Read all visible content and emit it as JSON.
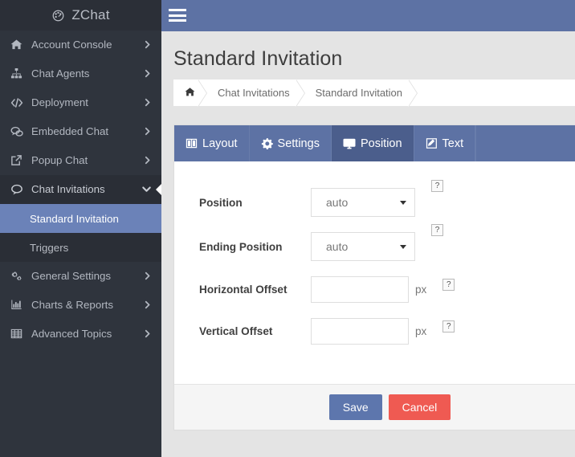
{
  "brand": {
    "label": "ZChat",
    "icon": "dashboard-icon"
  },
  "sidebar": {
    "items": [
      {
        "label": "Account Console",
        "icon": "home-icon"
      },
      {
        "label": "Chat Agents",
        "icon": "sitemap-icon"
      },
      {
        "label": "Deployment",
        "icon": "code-icon"
      },
      {
        "label": "Embedded Chat",
        "icon": "comments-icon"
      },
      {
        "label": "Popup Chat",
        "icon": "external-link-icon"
      },
      {
        "label": "Chat Invitations",
        "icon": "comment-icon"
      }
    ],
    "sub_items": [
      {
        "label": "Standard Invitation",
        "active": true
      },
      {
        "label": "Triggers",
        "active": false
      }
    ],
    "items_lower": [
      {
        "label": "General Settings",
        "icon": "cogs-icon"
      },
      {
        "label": "Charts & Reports",
        "icon": "bar-chart-icon"
      },
      {
        "label": "Advanced Topics",
        "icon": "table-icon"
      }
    ]
  },
  "header": {
    "menu_toggle": "hamburger-icon"
  },
  "page": {
    "title": "Standard Invitation",
    "breadcrumb": [
      {
        "label": "",
        "icon": "home-icon"
      },
      {
        "label": "Chat Invitations"
      },
      {
        "label": "Standard Invitation"
      }
    ]
  },
  "tabs": [
    {
      "label": "Layout",
      "icon": "columns-icon",
      "active": false
    },
    {
      "label": "Settings",
      "icon": "gear-icon",
      "active": false
    },
    {
      "label": "Position",
      "icon": "desktop-icon",
      "active": true
    },
    {
      "label": "Text",
      "icon": "pencil-square-icon",
      "active": false
    }
  ],
  "form": {
    "position": {
      "label": "Position",
      "value": "auto",
      "help": "?"
    },
    "ending_position": {
      "label": "Ending Position",
      "value": "auto",
      "help": "?"
    },
    "horizontal_offset": {
      "label": "Horizontal Offset",
      "value": "",
      "placeholder": "",
      "unit": "px",
      "help": "?"
    },
    "vertical_offset": {
      "label": "Vertical Offset",
      "value": "",
      "placeholder": "",
      "unit": "px",
      "help": "?"
    }
  },
  "footer": {
    "save_label": "Save",
    "cancel_label": "Cancel"
  },
  "colors": {
    "sidebar_bg": "#2f343d",
    "accent_blue": "#5d72a4",
    "active_tab": "#4b5e8c",
    "active_sub": "#6b82b8",
    "save": "#5d76ad",
    "cancel": "#ef5a52",
    "page_bg": "#e4e4e4"
  }
}
